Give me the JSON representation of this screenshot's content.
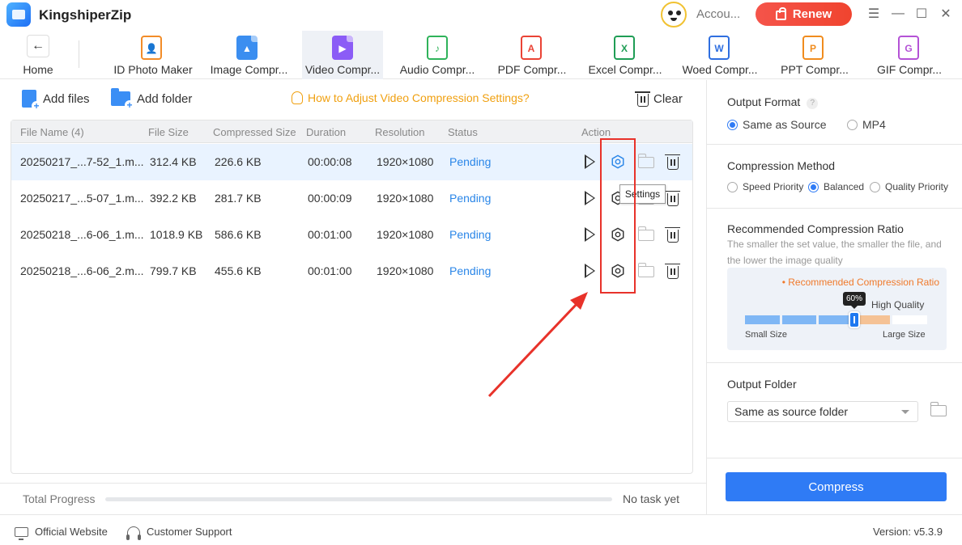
{
  "app": {
    "title": "KingshiperZip",
    "account_label": "Accou...",
    "renew_label": "Renew"
  },
  "window_controls": {
    "menu": "☰",
    "minimize": "—",
    "maximize": "☐",
    "close": "✕"
  },
  "nav": {
    "home_label": "Home",
    "tools": [
      {
        "label": "ID Photo Maker",
        "icon": "id-photo-icon",
        "color": "#f28c28",
        "glyph": "👤"
      },
      {
        "label": "Image Compr...",
        "icon": "image-icon",
        "color": "#3b8ef0",
        "glyph": "▲"
      },
      {
        "label": "Video Compr...",
        "icon": "video-icon",
        "color": "#8b5cf6",
        "glyph": "▶"
      },
      {
        "label": "Audio Compr...",
        "icon": "audio-icon",
        "color": "#2fb35a",
        "glyph": "♪"
      },
      {
        "label": "PDF Compr...",
        "icon": "pdf-icon",
        "color": "#ea4335",
        "glyph": "A"
      },
      {
        "label": "Excel Compr...",
        "icon": "excel-icon",
        "color": "#1f9d55",
        "glyph": "X"
      },
      {
        "label": "Woed Compr...",
        "icon": "word-icon",
        "color": "#2f6fe0",
        "glyph": "W"
      },
      {
        "label": "PPT Compr...",
        "icon": "ppt-icon",
        "color": "#f08c1e",
        "glyph": "P"
      },
      {
        "label": "GIF Compr...",
        "icon": "gif-icon",
        "color": "#b452d6",
        "glyph": "G"
      }
    ],
    "active_index": 2
  },
  "toolbar": {
    "add_files": "Add files",
    "add_folder": "Add folder",
    "howto": "How to Adjust Video Compression Settings?",
    "clear": "Clear"
  },
  "table": {
    "headers": {
      "file_name": "File Name  (4)",
      "file_size": "File Size",
      "compressed_size": "Compressed Size",
      "duration": "Duration",
      "resolution": "Resolution",
      "status": "Status",
      "action": "Action"
    },
    "rows": [
      {
        "name": "20250217_...7-52_1.m...",
        "size": "312.4 KB",
        "compressed": "226.6 KB",
        "duration": "00:00:08",
        "resolution": "1920×1080",
        "status": "Pending"
      },
      {
        "name": "20250217_...5-07_1.m...",
        "size": "392.2 KB",
        "compressed": "281.7 KB",
        "duration": "00:00:09",
        "resolution": "1920×1080",
        "status": "Pending"
      },
      {
        "name": "20250218_...6-06_1.m...",
        "size": "1018.9 KB",
        "compressed": "586.6 KB",
        "duration": "00:01:00",
        "resolution": "1920×1080",
        "status": "Pending"
      },
      {
        "name": "20250218_...6-06_2.m...",
        "size": "799.7 KB",
        "compressed": "455.6 KB",
        "duration": "00:01:00",
        "resolution": "1920×1080",
        "status": "Pending"
      }
    ],
    "tooltip": "Settings"
  },
  "progress": {
    "label": "Total Progress",
    "value": 0,
    "status": "No task yet"
  },
  "footer": {
    "website": "Official Website",
    "support": "Customer Support",
    "version": "Version: v5.3.9"
  },
  "settings": {
    "output_format": {
      "title": "Output Format",
      "help": "?",
      "options": [
        "Same as Source",
        "MP4"
      ],
      "selected": 0
    },
    "compression_method": {
      "title": "Compression Method",
      "options": [
        "Speed Priority",
        "Balanced",
        "Quality Priority"
      ],
      "selected": 1
    },
    "ratio": {
      "title": "Recommended Compression Ratio",
      "description": "The smaller the set value, the smaller the file, and the lower the image quality",
      "legend": "• Recommended Compression Ratio",
      "value_label": "60%",
      "value": 60,
      "high_quality": "High Quality",
      "small_size": "Small Size",
      "large_size": "Large Size"
    },
    "output_folder": {
      "title": "Output Folder",
      "value": "Same as source folder"
    },
    "compress_button": "Compress"
  },
  "colors": {
    "accent": "#2f7bf5",
    "renew": "#f0442f",
    "annotation": "#e8322a",
    "status_pending": "#2a86e8",
    "howto": "#f0a010"
  }
}
